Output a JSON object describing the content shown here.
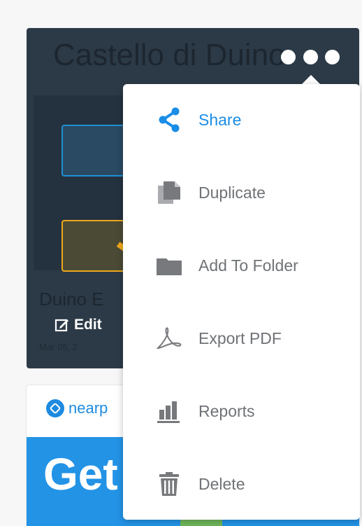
{
  "card": {
    "title": "Castello di Duino",
    "subtitle": "Duino E",
    "edit_label": "Edit",
    "date": "Mar 05, 2"
  },
  "second_card": {
    "brand": "nearp",
    "banner_text": "Get"
  },
  "menu": {
    "items": [
      {
        "label": "Share",
        "icon": "share-icon"
      },
      {
        "label": "Duplicate",
        "icon": "duplicate-icon"
      },
      {
        "label": "Add To Folder",
        "icon": "folder-icon"
      },
      {
        "label": "Export PDF",
        "icon": "pdf-icon"
      },
      {
        "label": "Reports",
        "icon": "reports-icon"
      },
      {
        "label": "Delete",
        "icon": "trash-icon"
      }
    ]
  },
  "colors": {
    "accent": "#1a8de6",
    "menu_text": "#6f7276",
    "icon_gray": "#77797c",
    "card_dark": "#2c3a47",
    "banner_blue": "#2393e6"
  }
}
